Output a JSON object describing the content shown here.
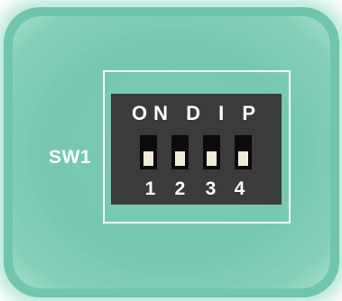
{
  "board": {
    "color": "#6fc6ad",
    "designator": "SW1"
  },
  "dip_switch": {
    "header": "ON D I P",
    "body_color": "#3b3b3b",
    "switches": [
      {
        "number": "1",
        "state": "off"
      },
      {
        "number": "2",
        "state": "off"
      },
      {
        "number": "3",
        "state": "off"
      },
      {
        "number": "4",
        "state": "off"
      }
    ]
  }
}
